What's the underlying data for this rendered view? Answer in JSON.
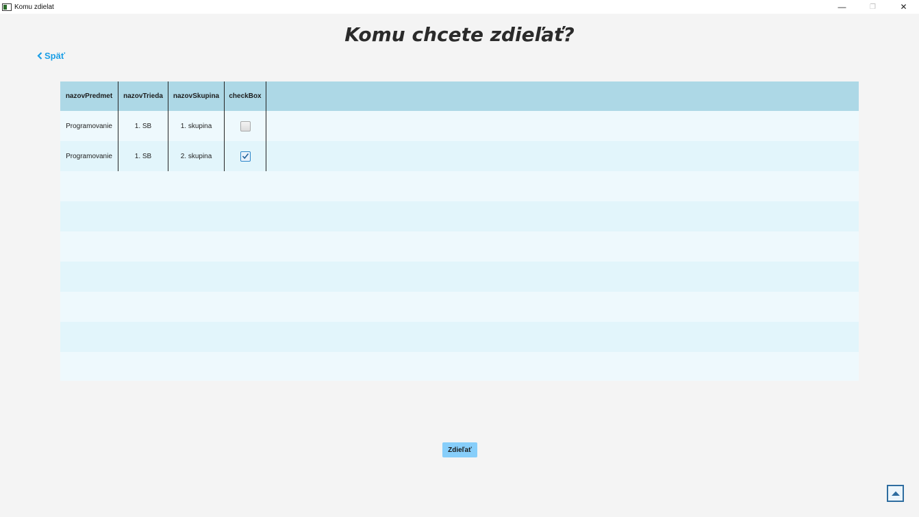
{
  "window": {
    "title": "Komu zdielat",
    "minimize_glyph": "—",
    "restore_glyph": "❐",
    "close_glyph": "✕"
  },
  "page": {
    "title": "Komu chcete zdieľať?",
    "back_label": "Späť",
    "back_icon": "chevron-left-icon",
    "share_button_label": "Zdieľať",
    "corner_icon": "arrow-up-icon"
  },
  "table": {
    "columns": [
      "nazovPredmet",
      "nazovTrieda",
      "nazovSkupina",
      "checkBox"
    ],
    "rows": [
      {
        "predmet": "Programovanie",
        "trieda": "1. SB",
        "skupina": "1. skupina",
        "checked": false
      },
      {
        "predmet": "Programovanie",
        "trieda": "1. SB",
        "skupina": "2. skupina",
        "checked": true
      }
    ]
  },
  "colors": {
    "accent": "#1a9ee6",
    "header_bg": "#add8e6",
    "button_bg": "#87cefa"
  }
}
